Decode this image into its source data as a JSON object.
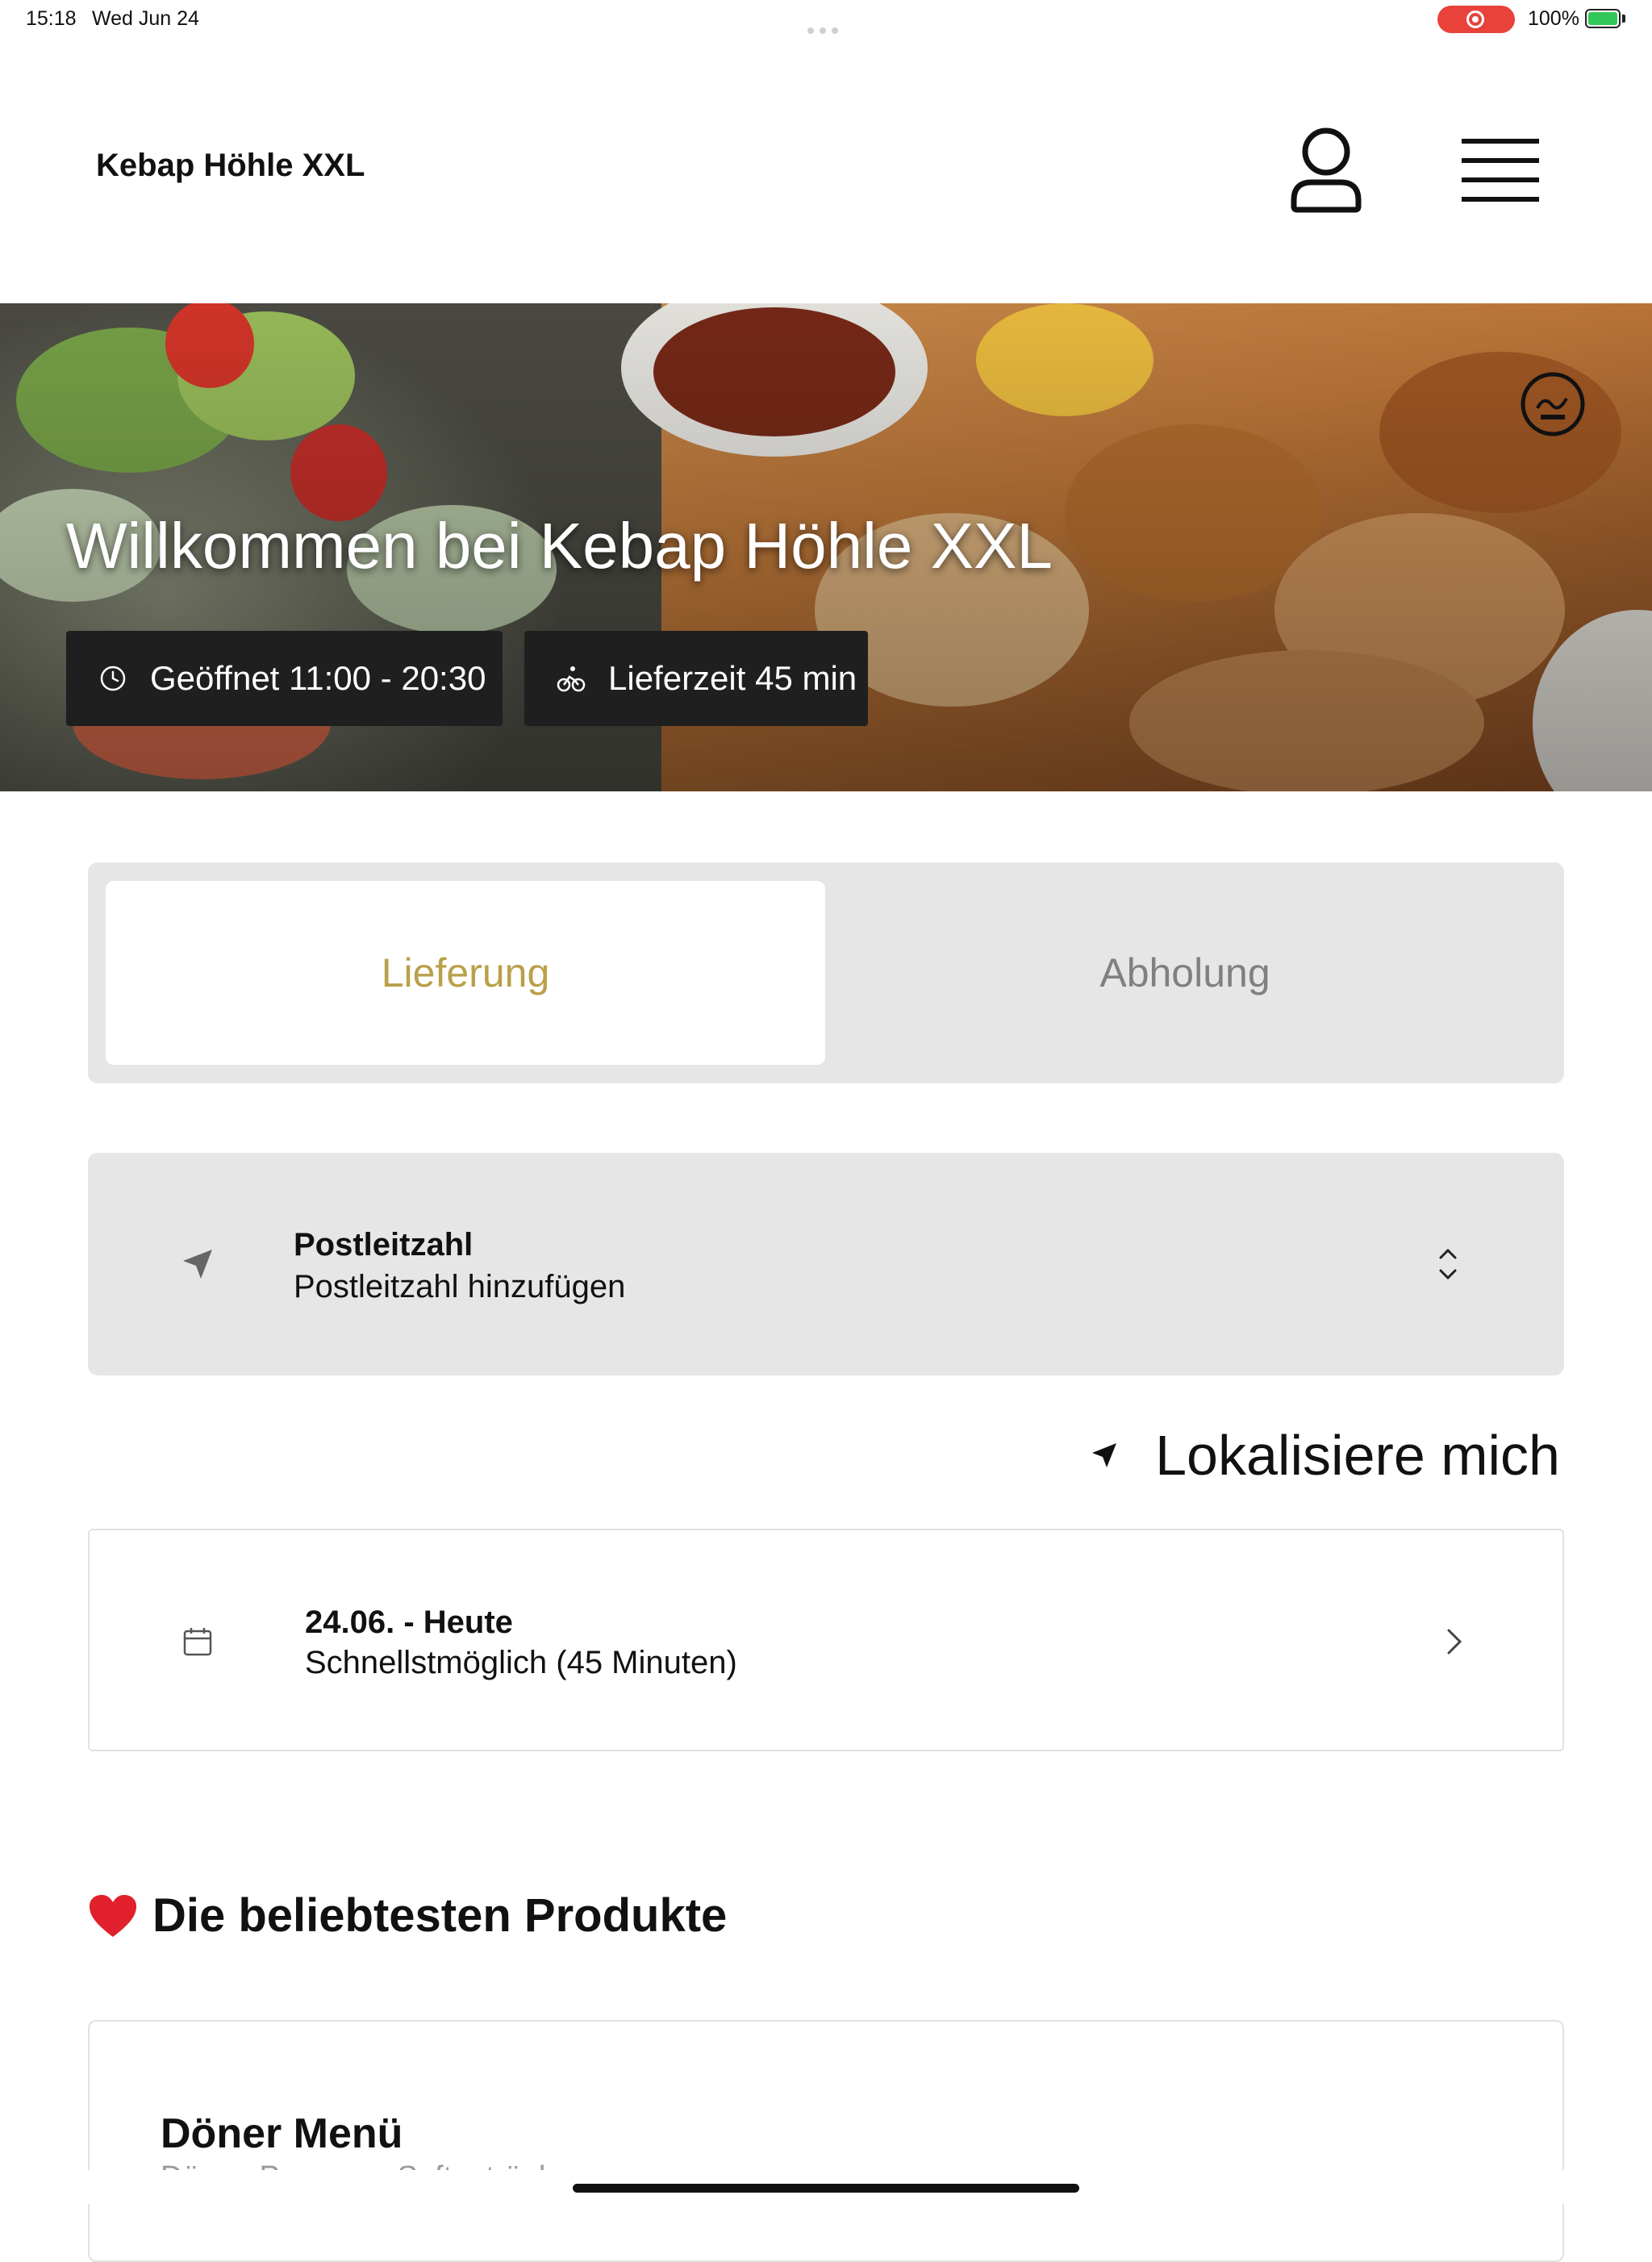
{
  "status_bar": {
    "time": "15:18",
    "date": "Wed Jun 24",
    "battery_percent": "100%",
    "recording_color": "#e8423b",
    "battery_color": "#32c759"
  },
  "header": {
    "brand": "Kebap Höhle XXL",
    "icons": [
      "user-icon",
      "menu-icon"
    ]
  },
  "hero": {
    "title": "Willkommen bei Kebap Höhle XXL",
    "hours": "Geöffnet 11:00 - 20:30",
    "delivery_time": "Lieferzeit 45 min",
    "icons": [
      "halal-icon",
      "clock-icon",
      "bike-icon"
    ]
  },
  "order_mode": {
    "tabs": [
      {
        "label": "Lieferung",
        "active": true
      },
      {
        "label": "Abholung",
        "active": false
      }
    ],
    "accent": "#b9a049"
  },
  "postcode": {
    "label": "Postleitzahl",
    "placeholder": "Postleitzahl hinzufügen"
  },
  "locate": {
    "label": "Lokalisiere mich"
  },
  "delivery_time_picker": {
    "date": "24.06. - Heute",
    "time": "Schnellstmöglich (45 Minuten)"
  },
  "popular": {
    "title": "Die beliebtesten Produkte",
    "products": [
      {
        "name": "Döner Menü",
        "description": "Döner, Pommes, Softgetränk"
      }
    ]
  }
}
